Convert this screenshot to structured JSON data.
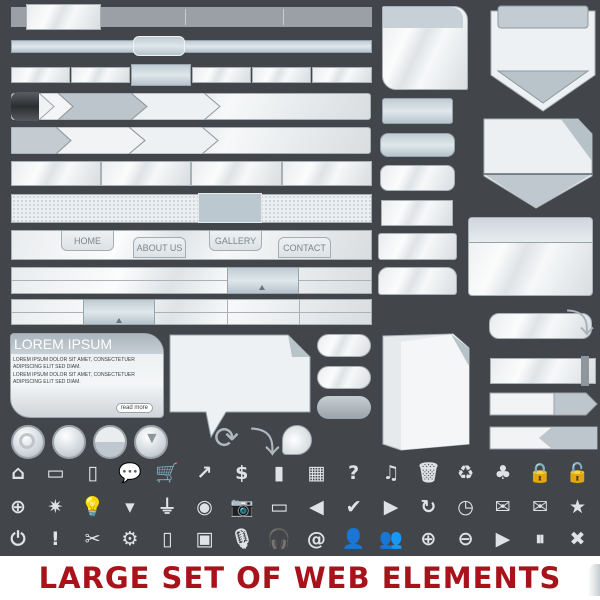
{
  "nav": {
    "home": "HOME",
    "about": "ABOUT US",
    "gallery": "GALLERY",
    "contact": "CONTACT"
  },
  "info_box": {
    "title": "LOREM IPSUM",
    "paragraph1": "LOREM IPSUM DOLOR SIT AMET, CONSECTETUER ADIPISCING ELIT SED DIAM.",
    "paragraph2": "LOREM IPSUM DOLOR SIT AMET, CONSECTETUER ADIPISCING ELIT SED DIAM.",
    "read_more": "read more"
  },
  "banner": {
    "title": "LARGE SET OF WEB ELEMENTS"
  },
  "colors": {
    "background": "#42464b",
    "banner_text": "#a8131b",
    "metal": "#e9ecee",
    "accent_blue_grey": "#bfcbd3"
  },
  "icons": {
    "row1": [
      {
        "name": "home-icon",
        "glyph": "⌂"
      },
      {
        "name": "folder-icon",
        "glyph": "▭"
      },
      {
        "name": "document-icon",
        "glyph": "▯"
      },
      {
        "name": "speech-bubble-icon",
        "glyph": "💬"
      },
      {
        "name": "shopping-cart-icon",
        "glyph": "🛒"
      },
      {
        "name": "trend-line-icon",
        "glyph": "↗"
      },
      {
        "name": "dollar-icon",
        "glyph": "$"
      },
      {
        "name": "bar-chart-icon",
        "glyph": "▮"
      },
      {
        "name": "film-icon",
        "glyph": "▦"
      },
      {
        "name": "question-icon",
        "glyph": "?"
      },
      {
        "name": "music-note-icon",
        "glyph": "♫"
      },
      {
        "name": "trash-icon",
        "glyph": "🗑"
      },
      {
        "name": "recycle-icon",
        "glyph": "♻"
      },
      {
        "name": "tree-icon",
        "glyph": "♣"
      },
      {
        "name": "lock-closed-icon",
        "glyph": "🔒"
      },
      {
        "name": "lock-open-icon",
        "glyph": "🔓"
      }
    ],
    "row2": [
      {
        "name": "globe-icon",
        "glyph": "⊕"
      },
      {
        "name": "light-burst-icon",
        "glyph": "✷"
      },
      {
        "name": "light-bulb-icon",
        "glyph": "💡"
      },
      {
        "name": "energy-bulb-icon",
        "glyph": "▾"
      },
      {
        "name": "usb-icon",
        "glyph": "⏚"
      },
      {
        "name": "disc-icon",
        "glyph": "◉"
      },
      {
        "name": "camera-icon",
        "glyph": "📷"
      },
      {
        "name": "monitor-icon",
        "glyph": "▭"
      },
      {
        "name": "arrow-left-icon",
        "glyph": "◀"
      },
      {
        "name": "checkmark-icon",
        "glyph": "✔"
      },
      {
        "name": "arrow-right-icon",
        "glyph": "▶"
      },
      {
        "name": "refresh-icon",
        "glyph": "↻"
      },
      {
        "name": "clock-icon",
        "glyph": "◷"
      },
      {
        "name": "mail-open-icon",
        "glyph": "✉"
      },
      {
        "name": "mail-icon",
        "glyph": "✉"
      },
      {
        "name": "star-icon",
        "glyph": "★"
      }
    ],
    "row3": [
      {
        "name": "power-icon",
        "glyph": "⏻"
      },
      {
        "name": "exclamation-icon",
        "glyph": "!"
      },
      {
        "name": "tools-icon",
        "glyph": "✂"
      },
      {
        "name": "gear-icon",
        "glyph": "⚙"
      },
      {
        "name": "mobile-phone-icon",
        "glyph": "▯"
      },
      {
        "name": "mp3-player-icon",
        "glyph": "▣"
      },
      {
        "name": "microphone-icon",
        "glyph": "🎙"
      },
      {
        "name": "headphones-icon",
        "glyph": "🎧"
      },
      {
        "name": "at-sign-icon",
        "glyph": "@"
      },
      {
        "name": "user-icon",
        "glyph": "👤"
      },
      {
        "name": "users-icon",
        "glyph": "👥"
      },
      {
        "name": "zoom-in-icon",
        "glyph": "⊕"
      },
      {
        "name": "zoom-out-icon",
        "glyph": "⊖"
      },
      {
        "name": "play-icon",
        "glyph": "▶"
      },
      {
        "name": "pause-icon",
        "glyph": "⏸"
      },
      {
        "name": "close-icon",
        "glyph": "✖"
      }
    ]
  }
}
